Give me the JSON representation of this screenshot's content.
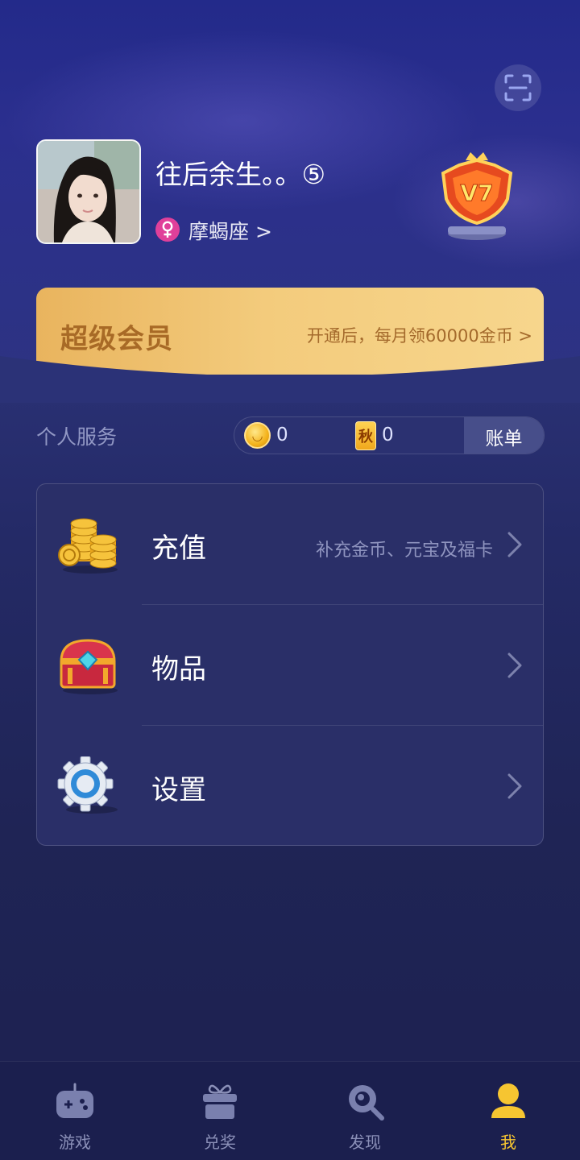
{
  "profile": {
    "username": "往后余生。。⑤",
    "constellation": "摩蝎座 >",
    "vip_level": "V7"
  },
  "vip_banner": {
    "title": "超级会员",
    "description": "开通后，每月领60000金币 >"
  },
  "services": {
    "label": "个人服务",
    "coin_value": "0",
    "card_glyph": "秋",
    "card_value": "0",
    "bill_label": "账单"
  },
  "menu": {
    "items": [
      {
        "label": "充值",
        "sub": "补充金币、元宝及福卡",
        "icon": "coins-icon"
      },
      {
        "label": "物品",
        "sub": "",
        "icon": "treasure-chest-icon"
      },
      {
        "label": "设置",
        "sub": "",
        "icon": "gear-icon"
      }
    ]
  },
  "tabbar": {
    "tabs": [
      {
        "label": "游戏",
        "icon": "gamepad-icon"
      },
      {
        "label": "兑奖",
        "icon": "gift-icon"
      },
      {
        "label": "发现",
        "icon": "discover-icon"
      },
      {
        "label": "我",
        "icon": "user-icon"
      }
    ],
    "active": 3
  },
  "colors": {
    "accent_gold": "#f6c531",
    "vip_banner": "#f3cb7c",
    "background": "#1e2150",
    "gender_pink": "#e0409a"
  }
}
